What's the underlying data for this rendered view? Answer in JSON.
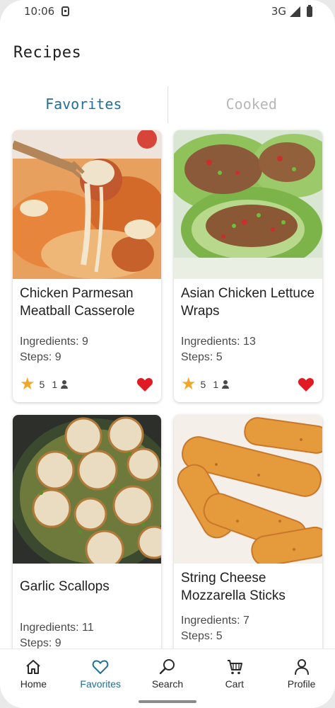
{
  "status_bar": {
    "time": "10:06",
    "network": "3G"
  },
  "header": {
    "title": "Recipes"
  },
  "tabs": [
    {
      "label": "Favorites",
      "active": true
    },
    {
      "label": "Cooked",
      "active": false
    }
  ],
  "recipes": [
    {
      "title": "Chicken Parmesan Meatball Casserole",
      "ingredients": "Ingredients: 9",
      "steps": "Steps: 9",
      "rating": "5",
      "cooked": "1",
      "favorite": true
    },
    {
      "title": "Asian Chicken Lettuce Wraps",
      "ingredients": "Ingredients: 13",
      "steps": "Steps: 5",
      "rating": "5",
      "cooked": "1",
      "favorite": true
    },
    {
      "title": "Garlic Scallops",
      "ingredients": "Ingredients: 11",
      "steps": "Steps: 9"
    },
    {
      "title": "String Cheese Mozzarella Sticks",
      "ingredients": "Ingredients: 7",
      "steps": "Steps: 5"
    }
  ],
  "nav": [
    {
      "label": "Home",
      "icon": "home-icon"
    },
    {
      "label": "Favorites",
      "icon": "heart-icon",
      "active": true
    },
    {
      "label": "Search",
      "icon": "search-icon"
    },
    {
      "label": "Cart",
      "icon": "cart-icon"
    },
    {
      "label": "Profile",
      "icon": "person-icon"
    }
  ],
  "colors": {
    "accent": "#1f6f98",
    "heart": "#e01b24",
    "star": "#f1a72a"
  }
}
